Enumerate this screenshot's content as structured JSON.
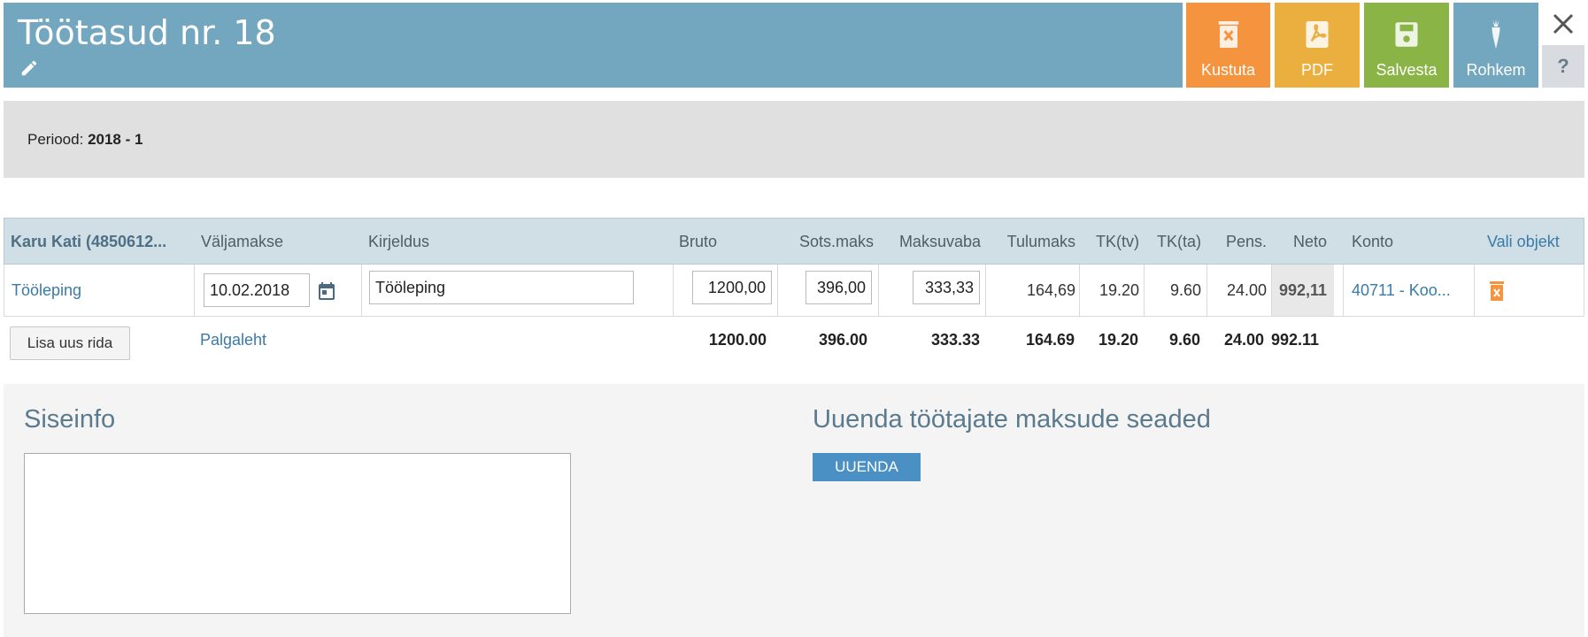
{
  "header": {
    "title": "Töötasud nr. 18",
    "buttons": {
      "delete": "Kustuta",
      "pdf": "PDF",
      "save": "Salvesta",
      "more": "Rohkem"
    },
    "help": "?"
  },
  "period": {
    "label": "Periood:",
    "value": "2018 - 1"
  },
  "table": {
    "headers": {
      "employee": "Karu Kati (4850612...",
      "payout": "Väljamakse",
      "description": "Kirjeldus",
      "gross": "Bruto",
      "social_tax": "Sots.maks",
      "tax_free": "Maksuvaba",
      "income_tax": "Tulumaks",
      "tk_tv": "TK(tv)",
      "tk_ta": "TK(ta)",
      "pension": "Pens.",
      "net": "Neto",
      "account": "Konto",
      "object": "Vali objekt"
    },
    "row": {
      "type": "Tööleping",
      "date": "10.02.2018",
      "description": "Tööleping",
      "gross": "1200,00",
      "social_tax": "396,00",
      "tax_free": "333,33",
      "income_tax": "164,69",
      "tk_tv": "19.20",
      "tk_ta": "9.60",
      "pension": "24.00",
      "net": "992,11",
      "account": "40711 - Koo..."
    },
    "add_row": "Lisa uus rida",
    "payslip_link": "Palgaleht",
    "totals": {
      "gross": "1200.00",
      "social_tax": "396.00",
      "tax_free": "333.33",
      "income_tax": "164.69",
      "tk_tv": "19.20",
      "tk_ta": "9.60",
      "pension": "24.00",
      "net": "992.11"
    }
  },
  "internal": {
    "title": "Siseinfo",
    "notes": ""
  },
  "update": {
    "title": "Uuenda töötajate maksude seaded",
    "button": "UUENDA"
  },
  "colors": {
    "header": "#72a7bf",
    "delete": "#f5943f",
    "pdf": "#eaaf3f",
    "save": "#8ab446",
    "link": "#3a7aa8"
  },
  "icons": [
    "edit-icon",
    "trash-icon",
    "pdf-icon",
    "floppy-icon",
    "carrot-icon",
    "close-icon",
    "calendar-icon",
    "delete-row-icon"
  ]
}
